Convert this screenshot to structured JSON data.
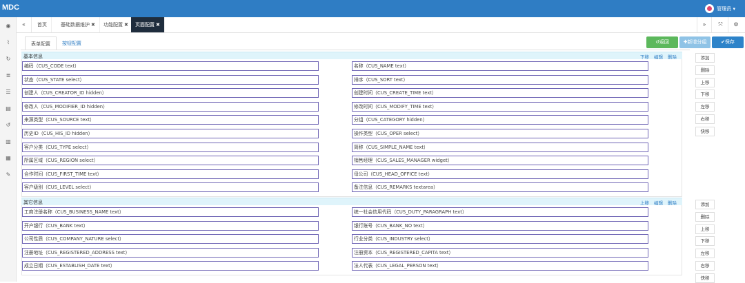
{
  "app": {
    "title": "MDC",
    "user": "管理员 ▾"
  },
  "sidebar_icons": [
    "dashboard-icon",
    "chart-icon",
    "refresh-icon",
    "database-icon",
    "list-icon",
    "id-card-icon",
    "history-icon",
    "book-icon",
    "calendar-icon",
    "wrench-icon"
  ],
  "tabs": [
    {
      "label": "首页",
      "closable": false,
      "active": false
    },
    {
      "label": "基础数据维护",
      "closable": true,
      "active": false
    },
    {
      "label": "功能配置",
      "closable": true,
      "active": false
    },
    {
      "label": "页面配置",
      "closable": true,
      "active": true
    }
  ],
  "tabnav": {
    "first": "«",
    "last": "»",
    "fullscreen": "⤧",
    "settings": "⚙"
  },
  "subtabs": [
    {
      "label": "表单配置",
      "active": true
    },
    {
      "label": "按钮配置",
      "active": false
    }
  ],
  "toolbar": {
    "back": "↺返回",
    "add_group": "✚新增分组",
    "save": "✔保存"
  },
  "colors": {
    "topbar": "#2f7dc4",
    "back": "#5cb85c",
    "add_group": "#8fc3e6",
    "save": "#2d83c9",
    "field_border": "#6d63b4"
  },
  "sections": [
    {
      "title": "基本信息",
      "actions": [
        "下移",
        "编辑",
        "删除"
      ],
      "rows": [
        [
          "编码（CUS_CODE text）",
          "名称（CUS_NAME text）"
        ],
        [
          "状态（CUS_STATE select）",
          "排序（CUS_SORT text）"
        ],
        [
          "创建人（CUS_CREATOR_ID hidden）",
          "创建时间（CUS_CREATE_TIME text）"
        ],
        [
          "修改人（CUS_MODIFIER_ID hidden）",
          "修改时间（CUS_MODIFY_TIME text）"
        ],
        [
          "来源类型（CUS_SOURCE text）",
          "分组（CUS_CATEGORY hidden）"
        ],
        [
          "历史ID（CUS_HIS_ID hidden）",
          "操作类型（CUS_OPER select）"
        ],
        [
          "客户分类（CUS_TYPE select）",
          "简称（CUS_SIMPLE_NAME text）"
        ],
        [
          "所属区域（CUS_REGION select）",
          "销售经理（CUS_SALES_MANAGER widget）"
        ],
        [
          "合作时间（CUS_FIRST_TIME text）",
          "母公司（CUS_HEAD_OFFICE text）"
        ],
        [
          "客户级别（CUS_LEVEL select）",
          "备注信息（CUS_REMARKS textarea）"
        ]
      ],
      "side_buttons": [
        "添加",
        "删除",
        "上移",
        "下移",
        "左移",
        "右移",
        "快移"
      ]
    },
    {
      "title": "其它信息",
      "actions": [
        "上移",
        "编辑",
        "删除"
      ],
      "rows": [
        [
          "工商注册名称（CUS_BUSINESS_NAME text）",
          "统一社会信用代码（CUS_DUTY_PARAGRAPH text）"
        ],
        [
          "开户银行（CUS_BANK text）",
          "银行账号（CUS_BANK_NO text）"
        ],
        [
          "公司性质（CUS_COMPANY_NATURE select）",
          "行业分类（CUS_INDUSTRY select）"
        ],
        [
          "注册地址（CUS_REGISTERED_ADDRESS text）",
          "注册资本（CUS_REGISTERED_CAPITA text）"
        ],
        [
          "成立日期（CUS_ESTABLISH_DATE text）",
          "法人代表（CUS_LEGAL_PERSON text）"
        ]
      ],
      "side_buttons": [
        "添加",
        "删除",
        "上移",
        "下移",
        "左移",
        "右移",
        "快移"
      ]
    }
  ]
}
